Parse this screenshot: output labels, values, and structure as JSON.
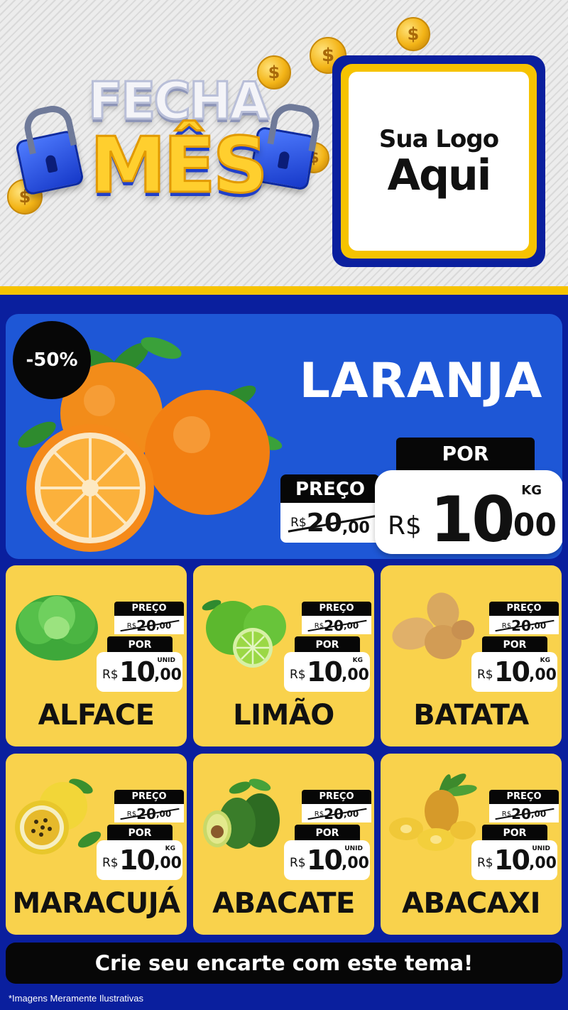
{
  "header": {
    "title_line1": "FECHA",
    "title_line2": "MÊS",
    "logo_line1": "Sua Logo",
    "logo_line2": "Aqui"
  },
  "featured": {
    "discount": "-50%",
    "name": "LARANJA",
    "por_label": "POR",
    "preco_label": "PREÇO",
    "old_price": {
      "currency": "R$",
      "integer": "20",
      "decimal": ",00"
    },
    "new_price": {
      "currency": "R$",
      "integer": "10",
      "decimal": ",00",
      "unit": "KG"
    }
  },
  "products": [
    {
      "name": "ALFACE",
      "preco_label": "PREÇO",
      "por_label": "POR",
      "old_price": {
        "currency": "R$",
        "integer": "20",
        "decimal": ",00"
      },
      "new_price": {
        "currency": "R$",
        "integer": "10",
        "decimal": ",00",
        "unit": "UNID"
      }
    },
    {
      "name": "LIMÃO",
      "preco_label": "PREÇO",
      "por_label": "POR",
      "old_price": {
        "currency": "R$",
        "integer": "20",
        "decimal": ",00"
      },
      "new_price": {
        "currency": "R$",
        "integer": "10",
        "decimal": ",00",
        "unit": "KG"
      }
    },
    {
      "name": "BATATA",
      "preco_label": "PREÇO",
      "por_label": "POR",
      "old_price": {
        "currency": "R$",
        "integer": "20",
        "decimal": ",00"
      },
      "new_price": {
        "currency": "R$",
        "integer": "10",
        "decimal": ",00",
        "unit": "KG"
      }
    },
    {
      "name": "MARACUJÁ",
      "preco_label": "PREÇO",
      "por_label": "POR",
      "old_price": {
        "currency": "R$",
        "integer": "20",
        "decimal": ",00"
      },
      "new_price": {
        "currency": "R$",
        "integer": "10",
        "decimal": ",00",
        "unit": "KG"
      }
    },
    {
      "name": "ABACATE",
      "preco_label": "PREÇO",
      "por_label": "POR",
      "old_price": {
        "currency": "R$",
        "integer": "20",
        "decimal": ",00"
      },
      "new_price": {
        "currency": "R$",
        "integer": "10",
        "decimal": ",00",
        "unit": "UNID"
      }
    },
    {
      "name": "ABACAXI",
      "preco_label": "PREÇO",
      "por_label": "POR",
      "old_price": {
        "currency": "R$",
        "integer": "20",
        "decimal": ",00"
      },
      "new_price": {
        "currency": "R$",
        "integer": "10",
        "decimal": ",00",
        "unit": "UNID"
      }
    }
  ],
  "footer": {
    "cta": "Crie seu encarte com este tema!",
    "disclaimer": "*Imagens Meramente Ilustrativas"
  },
  "colors": {
    "brand_blue": "#0a1f9e",
    "panel_blue": "#1e57d6",
    "accent_yellow": "#f6c300",
    "card_yellow": "#f9d24c",
    "black": "#070707"
  },
  "icons": [
    "coin-icon",
    "padlock-icon",
    "orange-image",
    "lettuce-image",
    "lime-image",
    "potato-image",
    "passion-fruit-image",
    "avocado-image",
    "pineapple-image"
  ]
}
